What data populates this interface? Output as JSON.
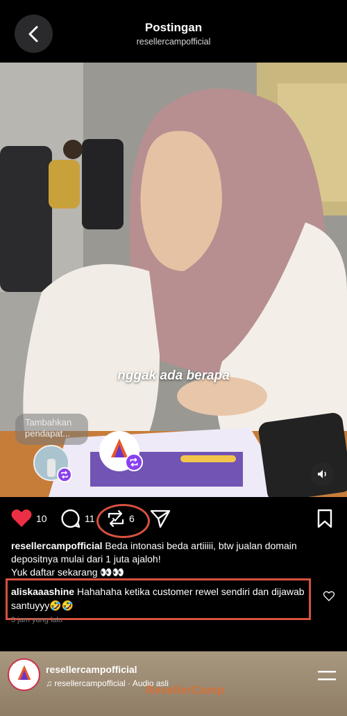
{
  "header": {
    "title": "Postingan",
    "username": "resellercampofficial"
  },
  "media": {
    "caption_overlay": "nggak ada berapa",
    "opinion_bubble": "Tambahkan pendapat...",
    "brand_avatar_text": "ResellerCamp"
  },
  "actions": {
    "likes": "10",
    "comments": "11",
    "reposts": "6",
    "highlight_color": "#d9513f",
    "like_color": "#ed2f45"
  },
  "post": {
    "author": "resellercampofficial",
    "caption": "Beda intonasi beda artiiiii, btw jualan domain depositnya mulai dari 1 juta ajaloh!",
    "caption_line2": "Yuk daftar sekarang 👀👀"
  },
  "comment": {
    "author": "aliskaaashine",
    "text": "Hahahaha ketika customer rewel sendiri dan dijawab santuyyy🤣🤣"
  },
  "time_ago": "3 jam yang lalu",
  "next_post": {
    "username": "resellercampofficial",
    "audio": "resellercampofficial · Audio asli",
    "watermark": "ResellerCamp"
  }
}
